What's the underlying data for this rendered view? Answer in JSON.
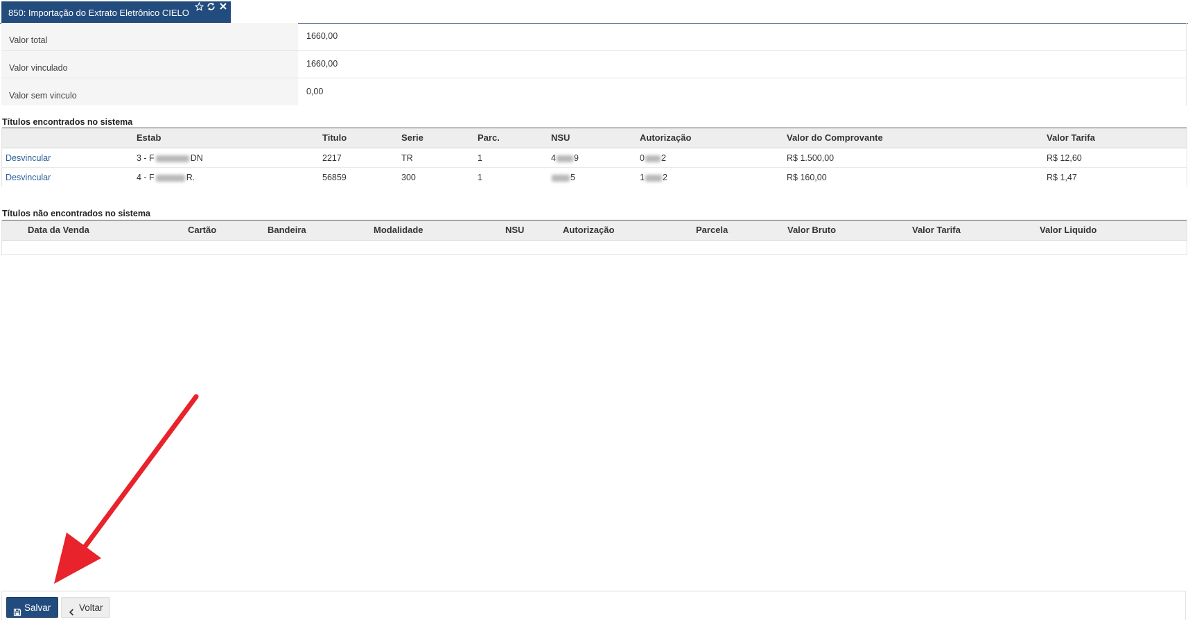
{
  "tab": {
    "title": "850: Importação do Extrato Eletrônico CIELO"
  },
  "summary": [
    {
      "label": "Valor total",
      "value": "1660,00"
    },
    {
      "label": "Valor vinculado",
      "value": "1660,00"
    },
    {
      "label": "Valor sem vinculo",
      "value": "0,00"
    }
  ],
  "found": {
    "title": "Títulos encontrados no sistema",
    "headers": [
      "Estab",
      "Titulo",
      "Serie",
      "Parc.",
      "NSU",
      "Autorização",
      "Valor do Comprovante",
      "Valor Tarifa"
    ],
    "rows": [
      {
        "action": "Desvincular",
        "estab_prefix": "3 - F",
        "estab_suffix": "DN",
        "titulo": "2217",
        "serie": "TR",
        "parc": "1",
        "nsu_prefix": "4",
        "nsu_suffix": "9",
        "aut_prefix": "0",
        "aut_suffix": "2",
        "valor": "R$ 1.500,00",
        "tarifa": "R$ 12,60"
      },
      {
        "action": "Desvincular",
        "estab_prefix": "4 - F",
        "estab_suffix": "R.",
        "titulo": "56859",
        "serie": "300",
        "parc": "1",
        "nsu_prefix": "",
        "nsu_suffix": "5",
        "aut_prefix": "1",
        "aut_suffix": "2",
        "valor": "R$ 160,00",
        "tarifa": "R$ 1,47"
      }
    ]
  },
  "notfound": {
    "title": "Títulos não encontrados no sistema",
    "headers": [
      "Data da Venda",
      "Cartão",
      "Bandeira",
      "Modalidade",
      "NSU",
      "Autorização",
      "Parcela",
      "Valor Bruto",
      "Valor Tarifa",
      "Valor Liquido"
    ]
  },
  "footer": {
    "save_label": "Salvar",
    "back_label": "Voltar"
  },
  "colors": {
    "primary": "#234c7e",
    "link": "#2a5d9a",
    "arrow": "#e8232b"
  }
}
